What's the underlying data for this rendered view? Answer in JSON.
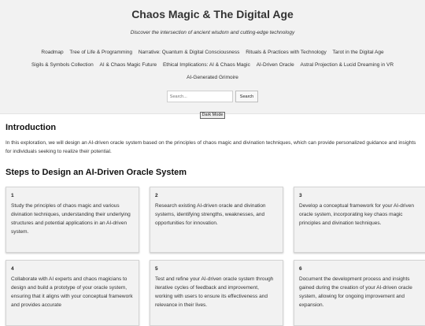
{
  "header": {
    "title": "Chaos Magic & The Digital Age",
    "tagline": "Discover the intersection of ancient wisdom and cutting-edge technology"
  },
  "nav": {
    "items": [
      "Roadmap",
      "Tree of Life & Programming",
      "Narrative: Quantum & Digital Consciousness",
      "Rituals & Practices with Technology",
      "Tarot in the Digital Age",
      "Sigils & Symbols Collection",
      "AI & Chaos Magic Future",
      "Ethical Implications: AI & Chaos Magic",
      "AI-Driven Oracle",
      "Astral Projection & Lucid Dreaming in VR",
      "AI-Generated Grimoire"
    ]
  },
  "search": {
    "placeholder": "Search...",
    "button_label": "Search"
  },
  "dark_mode_label": "Dark Mode",
  "intro": {
    "heading": "Introduction",
    "text": "In this exploration, we will design an AI-driven oracle system based on the principles of chaos magic and divination techniques, which can provide personalized guidance and insights for individuals seeking to realize their potential."
  },
  "steps": {
    "heading": "Steps to Design an AI-Driven Oracle System",
    "items": [
      {
        "number": "1",
        "text": "Study the principles of chaos magic and various divination techniques, understanding their underlying structures and potential applications in an AI-driven system."
      },
      {
        "number": "2",
        "text": "Research existing AI-driven oracle and divination systems, identifying strengths, weaknesses, and opportunities for innovation."
      },
      {
        "number": "3",
        "text": "Develop a conceptual framework for your AI-driven oracle system, incorporating key chaos magic principles and divination techniques."
      },
      {
        "number": "4",
        "text": "Collaborate with AI experts and chaos magicians to design and build a prototype of your oracle system, ensuring that it aligns with your conceptual framework and provides accurate"
      },
      {
        "number": "5",
        "text": "Test and refine your AI-driven oracle system through iterative cycles of feedback and improvement, working with users to ensure its effectiveness and relevance in their lives."
      },
      {
        "number": "6",
        "text": "Document the development process and insights gained during the creation of your AI-driven oracle system, allowing for ongoing improvement and expansion."
      }
    ]
  }
}
